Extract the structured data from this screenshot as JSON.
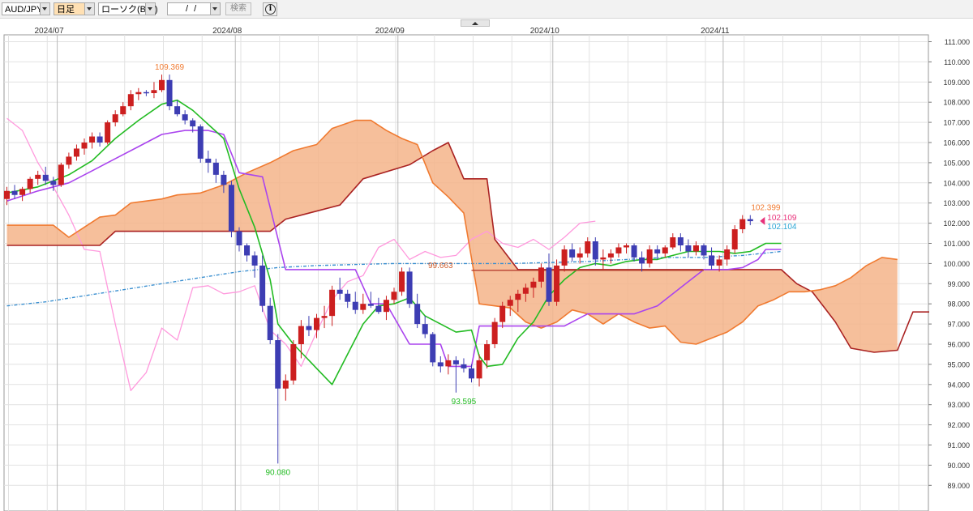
{
  "toolbar": {
    "symbol": "AUD/JPY",
    "period": "日足",
    "chart_kind": "ローソク(BID)",
    "date": "/ /",
    "search_label": "検索",
    "info_icon": "info-icon",
    "collapse_icon": "chevron-up-icon"
  },
  "colors": {
    "up": "#cc1f1f",
    "down": "#3d3db3",
    "tenkan": "#22bb22",
    "kijun": "#aa44ee",
    "chikou": "#ff99dd",
    "span_a": "#f07a30",
    "span_b": "#aa2222",
    "cloud": "#f5b48a",
    "ma": "#3a8fd0",
    "price_line": "#b84030",
    "label_high": "#f07a30",
    "label_low": "#22bb22",
    "current_bid": "#e8317a",
    "current_ask": "#2aa6d6"
  },
  "chart_data": {
    "type": "candlestick",
    "symbol": "AUD/JPY",
    "ylim": [
      88.6,
      111.3
    ],
    "y_ticks": [
      "111.000",
      "110.000",
      "109.000",
      "108.000",
      "107.000",
      "106.000",
      "105.000",
      "104.000",
      "103.000",
      "102.000",
      "101.000",
      "100.000",
      "99.000",
      "98.000",
      "97.000",
      "96.000",
      "95.000",
      "94.000",
      "93.000",
      "92.000",
      "91.000",
      "90.000",
      "89.000"
    ],
    "month_labels": [
      {
        "label": "2024/07",
        "index": 7
      },
      {
        "label": "2024/08",
        "index": 30
      },
      {
        "label": "2024/09",
        "index": 51
      },
      {
        "label": "2024/10",
        "index": 71
      },
      {
        "label": "2024/11",
        "index": 93
      }
    ],
    "annotations": [
      {
        "text": "109.369",
        "index": 21,
        "value": 109.369,
        "kind": "high"
      },
      {
        "text": "90.080",
        "index": 35,
        "value": 90.08,
        "kind": "low"
      },
      {
        "text": "93.595",
        "index": 59,
        "value": 93.595,
        "kind": "low"
      },
      {
        "text": "102.399",
        "index": 98,
        "value": 102.399,
        "kind": "high"
      }
    ],
    "current_bid": {
      "text": "102.109",
      "value": 102.109
    },
    "current_ask": {
      "text": "102.104",
      "value": 102.104
    },
    "price_line_label": {
      "text": "99.663",
      "value": 99.663
    },
    "candles": [
      [
        103.2,
        103.8,
        102.9,
        103.6
      ],
      [
        103.6,
        103.9,
        103.2,
        103.4
      ],
      [
        103.4,
        103.8,
        103.1,
        103.7
      ],
      [
        103.7,
        104.3,
        103.5,
        104.2
      ],
      [
        104.2,
        104.6,
        103.9,
        104.4
      ],
      [
        104.4,
        104.8,
        103.9,
        104.1
      ],
      [
        104.1,
        104.3,
        103.6,
        103.9
      ],
      [
        103.9,
        105.0,
        103.8,
        104.9
      ],
      [
        104.9,
        105.5,
        104.7,
        105.3
      ],
      [
        105.3,
        105.9,
        105.1,
        105.7
      ],
      [
        105.7,
        106.2,
        105.4,
        106.0
      ],
      [
        106.0,
        106.5,
        105.7,
        106.3
      ],
      [
        106.3,
        106.5,
        105.8,
        106.0
      ],
      [
        106.0,
        107.1,
        105.9,
        107.0
      ],
      [
        107.0,
        107.6,
        106.8,
        107.4
      ],
      [
        107.4,
        108.0,
        107.3,
        107.8
      ],
      [
        107.8,
        108.6,
        107.6,
        108.4
      ],
      [
        108.4,
        108.7,
        108.1,
        108.5
      ],
      [
        108.5,
        108.6,
        108.3,
        108.45
      ],
      [
        108.45,
        109.0,
        108.2,
        108.6
      ],
      [
        108.6,
        109.37,
        108.5,
        109.1
      ],
      [
        109.1,
        109.37,
        107.6,
        107.8
      ],
      [
        107.8,
        108.1,
        107.3,
        107.4
      ],
      [
        107.4,
        107.6,
        106.9,
        107.1
      ],
      [
        107.1,
        107.2,
        106.5,
        106.8
      ],
      [
        106.8,
        106.9,
        105.0,
        105.2
      ],
      [
        105.2,
        105.6,
        104.5,
        105.0
      ],
      [
        105.0,
        105.2,
        104.0,
        104.4
      ],
      [
        104.4,
        104.6,
        103.5,
        103.9
      ],
      [
        103.9,
        104.1,
        101.3,
        101.6
      ],
      [
        101.6,
        101.8,
        100.6,
        100.9
      ],
      [
        100.9,
        101.0,
        100.1,
        100.4
      ],
      [
        100.4,
        100.6,
        99.3,
        99.9
      ],
      [
        99.9,
        100.4,
        97.6,
        97.9
      ],
      [
        97.9,
        98.3,
        96.0,
        96.2
      ],
      [
        96.2,
        96.5,
        90.08,
        93.8
      ],
      [
        93.8,
        94.5,
        93.2,
        94.2
      ],
      [
        94.2,
        96.2,
        94.0,
        96.0
      ],
      [
        96.0,
        97.2,
        95.3,
        96.9
      ],
      [
        96.9,
        97.4,
        96.4,
        96.7
      ],
      [
        96.7,
        97.5,
        96.3,
        97.3
      ],
      [
        97.3,
        97.9,
        96.8,
        97.4
      ],
      [
        97.4,
        98.9,
        96.9,
        98.7
      ],
      [
        98.7,
        99.3,
        98.2,
        98.5
      ],
      [
        98.5,
        98.7,
        97.8,
        98.1
      ],
      [
        98.1,
        98.6,
        97.5,
        97.7
      ],
      [
        97.7,
        98.5,
        97.5,
        98.0
      ],
      [
        98.0,
        98.6,
        97.8,
        97.9
      ],
      [
        97.9,
        98.3,
        97.5,
        97.6
      ],
      [
        97.6,
        98.4,
        97.2,
        98.2
      ],
      [
        98.2,
        98.8,
        98.0,
        98.6
      ],
      [
        98.6,
        99.8,
        98.4,
        99.6
      ],
      [
        99.6,
        99.8,
        97.8,
        98.0
      ],
      [
        98.0,
        98.5,
        96.8,
        97.0
      ],
      [
        97.0,
        97.4,
        96.3,
        96.5
      ],
      [
        96.5,
        96.6,
        94.9,
        95.1
      ],
      [
        95.1,
        95.4,
        94.6,
        94.9
      ],
      [
        94.9,
        95.5,
        94.5,
        95.2
      ],
      [
        95.2,
        95.4,
        93.6,
        95.0
      ],
      [
        95.0,
        95.3,
        94.6,
        94.8
      ],
      [
        94.8,
        95.0,
        94.1,
        94.3
      ],
      [
        94.3,
        95.5,
        93.9,
        95.2
      ],
      [
        95.2,
        96.2,
        94.8,
        96.0
      ],
      [
        96.0,
        97.3,
        95.8,
        97.1
      ],
      [
        97.1,
        98.1,
        96.8,
        97.9
      ],
      [
        97.9,
        98.4,
        97.4,
        98.2
      ],
      [
        98.2,
        98.7,
        97.6,
        98.5
      ],
      [
        98.5,
        99.0,
        98.1,
        98.8
      ],
      [
        98.8,
        99.3,
        98.3,
        99.1
      ],
      [
        99.1,
        100.0,
        98.8,
        99.8
      ],
      [
        99.8,
        100.5,
        97.9,
        98.1
      ],
      [
        98.1,
        100.2,
        97.9,
        99.9
      ],
      [
        99.9,
        100.9,
        99.6,
        100.7
      ],
      [
        100.7,
        101.0,
        100.1,
        100.3
      ],
      [
        100.3,
        100.8,
        100.0,
        100.5
      ],
      [
        100.5,
        101.3,
        100.3,
        101.1
      ],
      [
        101.1,
        101.3,
        99.9,
        100.2
      ],
      [
        100.2,
        100.7,
        99.7,
        100.3
      ],
      [
        100.3,
        100.7,
        100.0,
        100.5
      ],
      [
        100.5,
        101.0,
        100.3,
        100.8
      ],
      [
        100.8,
        101.0,
        100.5,
        100.9
      ],
      [
        100.9,
        101.0,
        100.1,
        100.3
      ],
      [
        100.3,
        100.6,
        99.6,
        100.0
      ],
      [
        100.0,
        100.9,
        99.8,
        100.7
      ],
      [
        100.7,
        100.9,
        100.2,
        100.5
      ],
      [
        100.5,
        100.9,
        100.3,
        100.8
      ],
      [
        100.8,
        101.5,
        100.7,
        101.3
      ],
      [
        101.3,
        101.5,
        100.6,
        100.9
      ],
      [
        100.9,
        101.2,
        100.3,
        100.6
      ],
      [
        100.6,
        101.1,
        100.4,
        100.9
      ],
      [
        100.9,
        101.0,
        100.2,
        100.4
      ],
      [
        100.4,
        100.8,
        99.7,
        99.9
      ],
      [
        99.9,
        100.4,
        99.6,
        100.2
      ],
      [
        100.2,
        100.9,
        99.9,
        100.7
      ],
      [
        100.7,
        101.9,
        100.5,
        101.7
      ],
      [
        101.7,
        102.4,
        101.5,
        102.2
      ],
      [
        102.2,
        102.4,
        101.9,
        102.1
      ]
    ],
    "tenkan": [
      [
        0,
        103.5
      ],
      [
        4,
        103.8
      ],
      [
        8,
        104.4
      ],
      [
        11,
        105.1
      ],
      [
        14,
        106.2
      ],
      [
        17,
        107.1
      ],
      [
        20,
        107.9
      ],
      [
        22,
        108.1
      ],
      [
        24,
        107.6
      ],
      [
        26,
        106.9
      ],
      [
        28,
        106.2
      ],
      [
        30,
        103.7
      ],
      [
        32,
        101.8
      ],
      [
        34,
        99.2
      ],
      [
        35,
        97.0
      ],
      [
        37,
        96.0
      ],
      [
        40,
        94.8
      ],
      [
        42,
        94.0
      ],
      [
        44,
        95.5
      ],
      [
        46,
        97.0
      ],
      [
        48,
        97.9
      ],
      [
        50,
        98.0
      ],
      [
        52,
        98.3
      ],
      [
        54,
        97.4
      ],
      [
        56,
        97.0
      ],
      [
        58,
        96.6
      ],
      [
        60,
        96.7
      ],
      [
        61,
        95.4
      ],
      [
        62,
        94.9
      ],
      [
        64,
        95.0
      ],
      [
        66,
        96.3
      ],
      [
        68,
        97.1
      ],
      [
        70,
        98.4
      ],
      [
        72,
        99.2
      ],
      [
        74,
        99.8
      ],
      [
        76,
        100.0
      ],
      [
        78,
        99.9
      ],
      [
        80,
        100.1
      ],
      [
        82,
        100.2
      ],
      [
        84,
        100.2
      ],
      [
        86,
        100.4
      ],
      [
        88,
        100.6
      ],
      [
        90,
        100.6
      ],
      [
        92,
        100.6
      ],
      [
        94,
        100.5
      ],
      [
        96,
        100.6
      ],
      [
        98,
        101.0
      ],
      [
        100,
        101.0
      ]
    ],
    "kijun": [
      [
        0,
        103.1
      ],
      [
        4,
        103.6
      ],
      [
        8,
        104.0
      ],
      [
        11,
        104.6
      ],
      [
        14,
        105.2
      ],
      [
        17,
        105.8
      ],
      [
        20,
        106.4
      ],
      [
        23,
        106.6
      ],
      [
        26,
        106.6
      ],
      [
        28,
        106.4
      ],
      [
        30,
        104.5
      ],
      [
        33,
        104.3
      ],
      [
        36,
        99.7
      ],
      [
        45,
        99.7
      ],
      [
        47,
        98.0
      ],
      [
        49,
        98.0
      ],
      [
        52,
        96.0
      ],
      [
        56,
        96.0
      ],
      [
        57,
        94.9
      ],
      [
        60,
        94.9
      ],
      [
        61,
        96.9
      ],
      [
        68,
        96.9
      ],
      [
        72,
        96.9
      ],
      [
        75,
        97.5
      ],
      [
        78,
        97.5
      ],
      [
        81,
        97.5
      ],
      [
        84,
        97.9
      ],
      [
        86,
        98.5
      ],
      [
        88,
        99.1
      ],
      [
        90,
        99.7
      ],
      [
        93,
        99.7
      ],
      [
        95,
        99.8
      ],
      [
        97,
        100.2
      ],
      [
        98,
        100.7
      ],
      [
        100,
        100.7
      ]
    ],
    "chikou": [
      [
        0,
        107.2
      ],
      [
        2,
        106.6
      ],
      [
        4,
        105.0
      ],
      [
        6,
        103.8
      ],
      [
        8,
        102.4
      ],
      [
        10,
        100.7
      ],
      [
        12,
        100.6
      ],
      [
        14,
        97.0
      ],
      [
        16,
        93.7
      ],
      [
        18,
        94.6
      ],
      [
        20,
        96.8
      ],
      [
        22,
        96.2
      ],
      [
        24,
        98.8
      ],
      [
        26,
        98.9
      ],
      [
        28,
        98.5
      ],
      [
        30,
        98.6
      ],
      [
        32,
        98.9
      ],
      [
        34,
        96.7
      ],
      [
        36,
        96.0
      ],
      [
        38,
        94.9
      ],
      [
        40,
        96.6
      ],
      [
        42,
        98.2
      ],
      [
        44,
        99.1
      ],
      [
        46,
        99.4
      ],
      [
        48,
        100.8
      ],
      [
        50,
        101.2
      ],
      [
        52,
        100.2
      ],
      [
        54,
        100.6
      ],
      [
        56,
        100.3
      ],
      [
        58,
        100.4
      ],
      [
        60,
        101.2
      ],
      [
        62,
        101.6
      ],
      [
        64,
        101.0
      ],
      [
        66,
        100.8
      ],
      [
        68,
        101.2
      ],
      [
        70,
        100.7
      ],
      [
        72,
        101.3
      ],
      [
        74,
        102.0
      ],
      [
        76,
        102.1
      ]
    ],
    "span_a": [
      [
        0,
        101.9
      ],
      [
        6,
        101.9
      ],
      [
        8,
        101.3
      ],
      [
        10,
        101.8
      ],
      [
        12,
        102.3
      ],
      [
        14,
        102.4
      ],
      [
        16,
        103.0
      ],
      [
        18,
        103.1
      ],
      [
        20,
        103.2
      ],
      [
        22,
        103.4
      ],
      [
        25,
        103.5
      ],
      [
        28,
        103.9
      ],
      [
        31,
        104.5
      ],
      [
        34,
        105.0
      ],
      [
        37,
        105.6
      ],
      [
        40,
        105.9
      ],
      [
        42,
        106.7
      ],
      [
        45,
        107.1
      ],
      [
        47,
        107.1
      ],
      [
        49,
        106.6
      ],
      [
        51,
        106.2
      ],
      [
        53,
        105.9
      ],
      [
        55,
        104.0
      ],
      [
        57,
        103.3
      ],
      [
        59,
        102.5
      ],
      [
        61,
        98.0
      ],
      [
        63,
        97.9
      ],
      [
        65,
        97.8
      ],
      [
        67,
        97.1
      ],
      [
        69,
        96.8
      ],
      [
        71,
        97.1
      ],
      [
        73,
        97.7
      ],
      [
        75,
        97.5
      ],
      [
        77,
        97.0
      ],
      [
        79,
        97.5
      ],
      [
        81,
        97.1
      ],
      [
        83,
        96.8
      ],
      [
        85,
        96.9
      ],
      [
        87,
        96.1
      ],
      [
        89,
        96.0
      ],
      [
        91,
        96.3
      ],
      [
        93,
        96.6
      ],
      [
        95,
        97.1
      ],
      [
        97,
        97.9
      ],
      [
        99,
        98.2
      ],
      [
        101,
        98.6
      ],
      [
        103,
        98.6
      ],
      [
        105,
        98.7
      ],
      [
        107,
        98.9
      ],
      [
        109,
        99.3
      ],
      [
        111,
        99.9
      ],
      [
        113,
        100.3
      ],
      [
        115,
        100.2
      ]
    ],
    "span_b": [
      [
        0,
        100.9
      ],
      [
        12,
        100.9
      ],
      [
        14,
        101.6
      ],
      [
        34,
        101.6
      ],
      [
        36,
        102.2
      ],
      [
        43,
        102.9
      ],
      [
        46,
        104.2
      ],
      [
        52,
        104.9
      ],
      [
        55,
        105.6
      ],
      [
        57,
        106.0
      ],
      [
        59,
        104.2
      ],
      [
        62,
        104.2
      ],
      [
        63,
        101.2
      ],
      [
        66,
        99.7
      ],
      [
        100,
        99.7
      ],
      [
        102,
        99.0
      ],
      [
        104,
        98.6
      ],
      [
        105,
        98.1
      ],
      [
        107,
        97.1
      ],
      [
        109,
        95.8
      ],
      [
        112,
        95.6
      ],
      [
        115,
        95.7
      ],
      [
        117,
        97.6
      ],
      [
        126,
        97.6
      ]
    ],
    "ma": [
      [
        0,
        97.9
      ],
      [
        5,
        98.1
      ],
      [
        10,
        98.4
      ],
      [
        15,
        98.7
      ],
      [
        20,
        99.0
      ],
      [
        25,
        99.3
      ],
      [
        30,
        99.6
      ],
      [
        35,
        99.8
      ],
      [
        40,
        99.9
      ],
      [
        45,
        99.95
      ],
      [
        50,
        100.0
      ],
      [
        55,
        100.0
      ],
      [
        60,
        100.0
      ],
      [
        65,
        100.0
      ],
      [
        70,
        100.05
      ],
      [
        75,
        100.1
      ],
      [
        80,
        100.2
      ],
      [
        85,
        100.3
      ],
      [
        90,
        100.3
      ],
      [
        95,
        100.4
      ],
      [
        100,
        100.6
      ]
    ]
  }
}
